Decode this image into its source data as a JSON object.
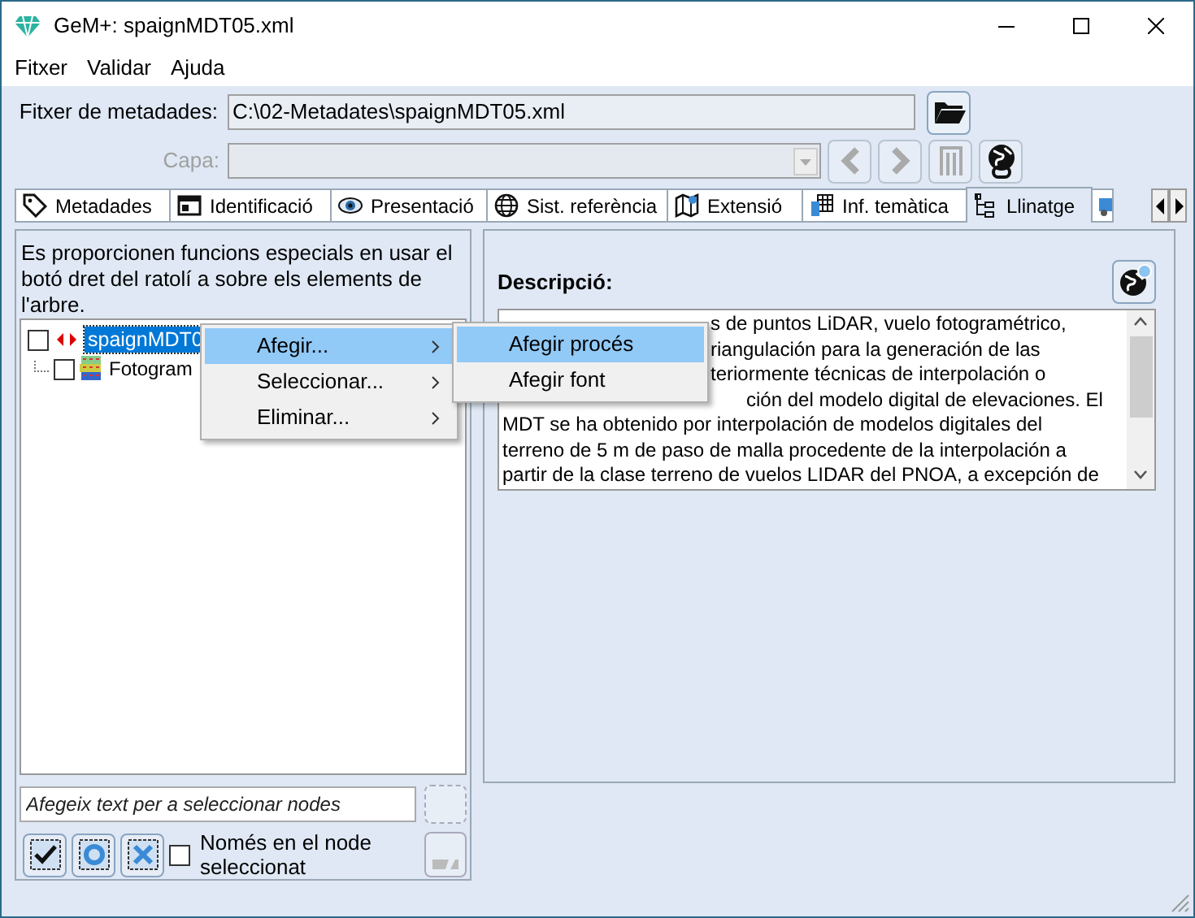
{
  "window": {
    "title": "GeM+: spaignMDT05.xml"
  },
  "menu": [
    "Fitxer",
    "Validar",
    "Ajuda"
  ],
  "file_field": {
    "label": "Fitxer de metadades:",
    "value": "C:\\02-Metadates\\spaignMDT05.xml"
  },
  "layer_field": {
    "label": "Capa:",
    "disabled": true
  },
  "tabs": [
    {
      "kind": "tag",
      "label": "Metadades",
      "selected": false
    },
    {
      "kind": "card",
      "label": "Identificació",
      "selected": false
    },
    {
      "kind": "eye",
      "label": "Presentació",
      "selected": false
    },
    {
      "kind": "globe",
      "label": "Sist. referència",
      "selected": false
    },
    {
      "kind": "map",
      "label": "Extensió",
      "selected": false
    },
    {
      "kind": "table",
      "label": "Inf. temàtica",
      "selected": false
    },
    {
      "kind": "tree",
      "label": "Llinatge",
      "selected": true
    },
    {
      "kind": "truck",
      "selected": false
    }
  ],
  "left_panel": {
    "help": "Es proporcionen funcions especials en usar el botó dret del ratolí a sobre els elements de l'arbre.",
    "tree": [
      {
        "label": "spaignMDT0",
        "checked": false,
        "selected": true,
        "children": [
          {
            "label": "Fotogram",
            "checked": false,
            "selected": false
          }
        ]
      }
    ],
    "filter": {
      "placeholder": "Afegeix text per a seleccionar nodes"
    },
    "only_selected": {
      "label": "Només en el node seleccionat",
      "checked": false
    }
  },
  "right_panel": {
    "label": "Descripció:",
    "lines": [
      {
        "kind": "partial",
        "text": "s de puntos LiDAR, vuelo fotogramétrico,"
      },
      {
        "kind": "partial",
        "text": "riangulación para la generación de las"
      },
      {
        "kind": "partial",
        "text": "teriormente técnicas de interpolación o"
      },
      {
        "kind": "partial2",
        "text": "ción del modelo digital de elevaciones. El"
      },
      {
        "kind": "full",
        "text": "MDT se ha obtenido por interpolación de modelos digitales del"
      },
      {
        "kind": "full",
        "text": "terreno de 5 m de paso de malla procedente de la interpolación a"
      },
      {
        "kind": "full",
        "text": "partir de la clase terreno de vuelos LIDAR del PNOA, a excepción de"
      }
    ]
  },
  "context_menu": [
    {
      "label": "Afegir...",
      "selected": true
    },
    {
      "label": "Seleccionar...",
      "selected": false
    },
    {
      "label": "Eliminar...",
      "selected": false
    }
  ],
  "submenu": [
    {
      "label": "Afegir procés",
      "selected": true
    },
    {
      "label": "Afegir font",
      "selected": false
    }
  ]
}
